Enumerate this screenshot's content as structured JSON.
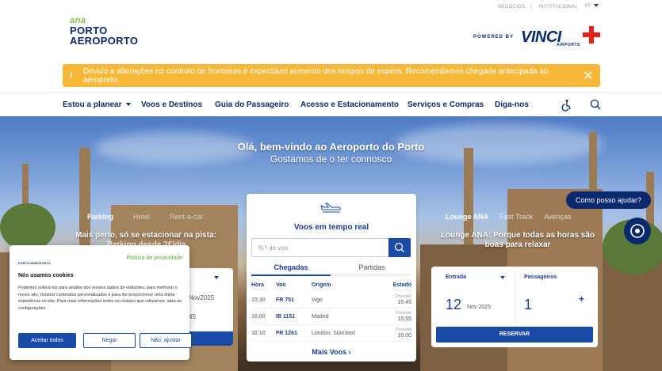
{
  "utility": {
    "links": [
      "NEGÓCIOS",
      "INSTITUCIONAL"
    ],
    "lang": "PT"
  },
  "logo": {
    "mark": "ana",
    "line1": "PORTO",
    "line2": "AEROPORTO"
  },
  "partner": {
    "powered": "POWERED BY",
    "brand": "VINCI",
    "sub": "AIRPORTS"
  },
  "alert": {
    "icon": "!",
    "message": "Devido a alterações no controlo de fronteiras é expectável aumento dos tempos de espera. Recomendamos chegada antecipada ao aeroporto.",
    "close": "✕"
  },
  "nav": {
    "items": [
      "Estou a planear",
      "Voos e Destinos",
      "Guia do Passageiro",
      "Acesso e Estacionamento",
      "Serviços e Compras",
      "Diga-nos"
    ],
    "icons": [
      "accessibility-icon",
      "search-icon"
    ]
  },
  "hero": {
    "title": "Olá, bem-vindo ao Aeroporto do Porto",
    "subtitle": "Gostamos de o ter connosco"
  },
  "parking": {
    "tabs": [
      "Parking",
      "Hotel",
      "Rent-a-car"
    ],
    "headline": "Mais perto, só se estacionar na pista:",
    "headline2": "Parking desde 2€/dia",
    "card_value1": "Nov2025",
    "card_value2": "45"
  },
  "flights": {
    "title": "Voos em tempo real",
    "search_placeholder": "N.º de voo",
    "tabs": [
      "Chegadas",
      "Partidas"
    ],
    "headers": [
      "Hora",
      "Voo",
      "Origem",
      "Estado"
    ],
    "rows": [
      {
        "time": "15:30",
        "flight": "FR 751",
        "origin": "Vigo",
        "status_label": "Previsto",
        "status_time": "15:45"
      },
      {
        "time": "16:00",
        "flight": "IB 1151",
        "origin": "Madrid",
        "status_label": "Previsto",
        "status_time": "15:55"
      },
      {
        "time": "16:10",
        "flight": "FR 1261",
        "origin": "London, Stansted",
        "status_label": "Previsto",
        "status_time": "16:00"
      }
    ],
    "more": "Mais Voos ›"
  },
  "lounge": {
    "tabs": [
      "Lounge ANA",
      "Fast Track",
      "Avenças"
    ],
    "headline": "Lounge ANA: Porque todas as horas são boas para relaxar",
    "entry_label": "Entrada",
    "day": "12",
    "month": "Nov 2025",
    "pax_label": "Passageiros",
    "pax": "1",
    "plus": "+",
    "reserve": "RESERVAR"
  },
  "chat": {
    "bubble": "Como posso ajudar?"
  },
  "cookie": {
    "mini_logo": "PORTO AEROPORTO",
    "privacy": "Política de privacidade",
    "title": "Nós usamos cookies",
    "text": "Podemos colocá-los para análise dos nossos dados de visitantes, para melhorar o nosso site, mostrar conteúdos personalizados e para lhe proporcionar uma ótima experiência no site. Para mais informações sobre os cookies que utilizamos, abra as configurações.",
    "accept": "Aceitar todos",
    "deny": "Negar",
    "adjust": "Não, ajustar"
  },
  "colors": {
    "brand_blue": "#0b2a6e",
    "action_blue": "#1a4aa8",
    "alert": "#f7b83a",
    "green": "#7cc241"
  }
}
